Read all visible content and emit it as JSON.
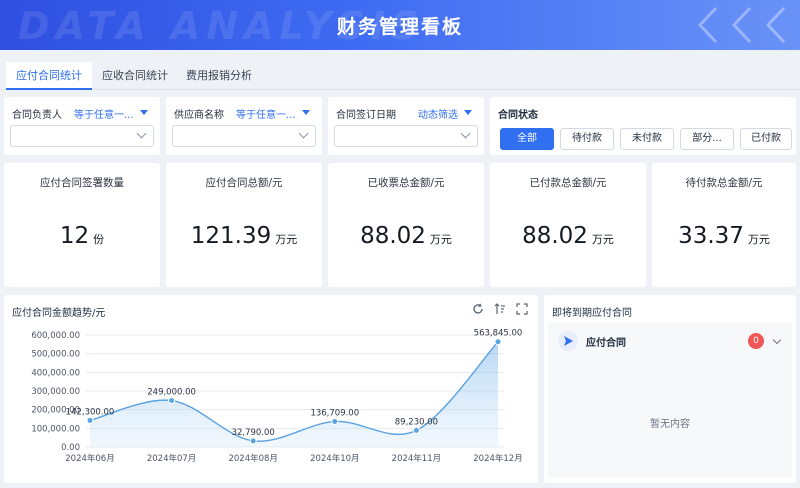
{
  "header": {
    "bg_text": "DATA ANALYSIS",
    "title": "财务管理看板"
  },
  "tabs": [
    {
      "label": "应付合同统计",
      "active": true
    },
    {
      "label": "应收合同统计",
      "active": false
    },
    {
      "label": "费用报销分析",
      "active": false
    }
  ],
  "filters": [
    {
      "label": "合同负责人",
      "op": "等于任意一...",
      "value": ""
    },
    {
      "label": "供应商名称",
      "op": "等于任意一...",
      "value": ""
    },
    {
      "label": "合同签订日期",
      "op": "动态筛选",
      "value": ""
    }
  ],
  "status_filter": {
    "label": "合同状态",
    "options": [
      "全部",
      "待付款",
      "未付款",
      "部分...",
      "已付款"
    ],
    "selected": "全部"
  },
  "kpis": [
    {
      "label": "应付合同签署数量",
      "value": "12",
      "unit": "份"
    },
    {
      "label": "应付合同总额/元",
      "value": "121.39",
      "unit": "万元"
    },
    {
      "label": "已收票总金额/元",
      "value": "88.02",
      "unit": "万元"
    },
    {
      "label": "已付款总金额/元",
      "value": "88.02",
      "unit": "万元"
    },
    {
      "label": "待付款总金额/元",
      "value": "33.37",
      "unit": "万元"
    }
  ],
  "trend_panel": {
    "title": "应付合同金额趋势/元",
    "tools": [
      "refresh-icon",
      "sort-icon",
      "fullscreen-icon"
    ]
  },
  "chart_data": {
    "type": "area",
    "categories": [
      "2024年06月",
      "2024年07月",
      "2024年08月",
      "2024年10月",
      "2024年11月",
      "2024年12月"
    ],
    "values": [
      142300,
      249000,
      32790,
      136709,
      89230,
      563845
    ],
    "value_labels": [
      "142,300.00",
      "249,000.00",
      "32,790.00",
      "136,709.00",
      "89,230.00",
      "563,845.00"
    ],
    "yticks": [
      "0.00",
      "100,000.00",
      "200,000.00",
      "300,000.00",
      "400,000.00",
      "500,000.00",
      "600,000.00"
    ],
    "ylim": [
      0,
      600000
    ],
    "grid": true,
    "color": "#5aa2e0"
  },
  "due_panel": {
    "title": "即将到期应付合同",
    "item_label": "应付合同",
    "count": "0",
    "empty_text": "暂无内容"
  },
  "colors": {
    "accent": "#2f6ff0",
    "badge": "#f25656",
    "header_start": "#2f4fe0",
    "header_end": "#6a93f7"
  }
}
